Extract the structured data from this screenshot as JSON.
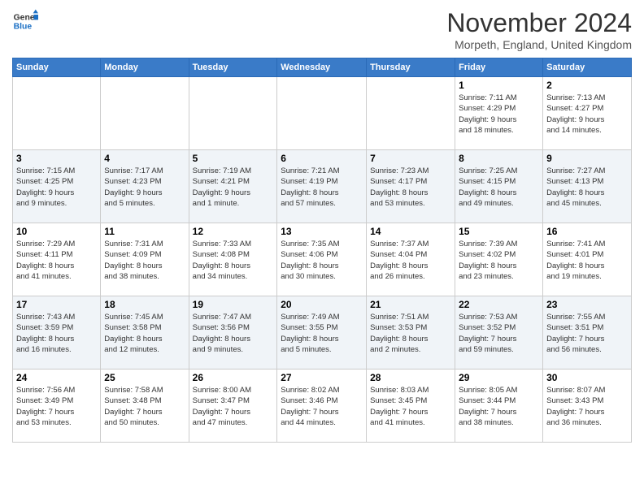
{
  "header": {
    "logo_line1": "General",
    "logo_line2": "Blue",
    "month": "November 2024",
    "location": "Morpeth, England, United Kingdom"
  },
  "weekdays": [
    "Sunday",
    "Monday",
    "Tuesday",
    "Wednesday",
    "Thursday",
    "Friday",
    "Saturday"
  ],
  "weeks": [
    [
      {
        "day": "",
        "info": ""
      },
      {
        "day": "",
        "info": ""
      },
      {
        "day": "",
        "info": ""
      },
      {
        "day": "",
        "info": ""
      },
      {
        "day": "",
        "info": ""
      },
      {
        "day": "1",
        "info": "Sunrise: 7:11 AM\nSunset: 4:29 PM\nDaylight: 9 hours\nand 18 minutes."
      },
      {
        "day": "2",
        "info": "Sunrise: 7:13 AM\nSunset: 4:27 PM\nDaylight: 9 hours\nand 14 minutes."
      }
    ],
    [
      {
        "day": "3",
        "info": "Sunrise: 7:15 AM\nSunset: 4:25 PM\nDaylight: 9 hours\nand 9 minutes."
      },
      {
        "day": "4",
        "info": "Sunrise: 7:17 AM\nSunset: 4:23 PM\nDaylight: 9 hours\nand 5 minutes."
      },
      {
        "day": "5",
        "info": "Sunrise: 7:19 AM\nSunset: 4:21 PM\nDaylight: 9 hours\nand 1 minute."
      },
      {
        "day": "6",
        "info": "Sunrise: 7:21 AM\nSunset: 4:19 PM\nDaylight: 8 hours\nand 57 minutes."
      },
      {
        "day": "7",
        "info": "Sunrise: 7:23 AM\nSunset: 4:17 PM\nDaylight: 8 hours\nand 53 minutes."
      },
      {
        "day": "8",
        "info": "Sunrise: 7:25 AM\nSunset: 4:15 PM\nDaylight: 8 hours\nand 49 minutes."
      },
      {
        "day": "9",
        "info": "Sunrise: 7:27 AM\nSunset: 4:13 PM\nDaylight: 8 hours\nand 45 minutes."
      }
    ],
    [
      {
        "day": "10",
        "info": "Sunrise: 7:29 AM\nSunset: 4:11 PM\nDaylight: 8 hours\nand 41 minutes."
      },
      {
        "day": "11",
        "info": "Sunrise: 7:31 AM\nSunset: 4:09 PM\nDaylight: 8 hours\nand 38 minutes."
      },
      {
        "day": "12",
        "info": "Sunrise: 7:33 AM\nSunset: 4:08 PM\nDaylight: 8 hours\nand 34 minutes."
      },
      {
        "day": "13",
        "info": "Sunrise: 7:35 AM\nSunset: 4:06 PM\nDaylight: 8 hours\nand 30 minutes."
      },
      {
        "day": "14",
        "info": "Sunrise: 7:37 AM\nSunset: 4:04 PM\nDaylight: 8 hours\nand 26 minutes."
      },
      {
        "day": "15",
        "info": "Sunrise: 7:39 AM\nSunset: 4:02 PM\nDaylight: 8 hours\nand 23 minutes."
      },
      {
        "day": "16",
        "info": "Sunrise: 7:41 AM\nSunset: 4:01 PM\nDaylight: 8 hours\nand 19 minutes."
      }
    ],
    [
      {
        "day": "17",
        "info": "Sunrise: 7:43 AM\nSunset: 3:59 PM\nDaylight: 8 hours\nand 16 minutes."
      },
      {
        "day": "18",
        "info": "Sunrise: 7:45 AM\nSunset: 3:58 PM\nDaylight: 8 hours\nand 12 minutes."
      },
      {
        "day": "19",
        "info": "Sunrise: 7:47 AM\nSunset: 3:56 PM\nDaylight: 8 hours\nand 9 minutes."
      },
      {
        "day": "20",
        "info": "Sunrise: 7:49 AM\nSunset: 3:55 PM\nDaylight: 8 hours\nand 5 minutes."
      },
      {
        "day": "21",
        "info": "Sunrise: 7:51 AM\nSunset: 3:53 PM\nDaylight: 8 hours\nand 2 minutes."
      },
      {
        "day": "22",
        "info": "Sunrise: 7:53 AM\nSunset: 3:52 PM\nDaylight: 7 hours\nand 59 minutes."
      },
      {
        "day": "23",
        "info": "Sunrise: 7:55 AM\nSunset: 3:51 PM\nDaylight: 7 hours\nand 56 minutes."
      }
    ],
    [
      {
        "day": "24",
        "info": "Sunrise: 7:56 AM\nSunset: 3:49 PM\nDaylight: 7 hours\nand 53 minutes."
      },
      {
        "day": "25",
        "info": "Sunrise: 7:58 AM\nSunset: 3:48 PM\nDaylight: 7 hours\nand 50 minutes."
      },
      {
        "day": "26",
        "info": "Sunrise: 8:00 AM\nSunset: 3:47 PM\nDaylight: 7 hours\nand 47 minutes."
      },
      {
        "day": "27",
        "info": "Sunrise: 8:02 AM\nSunset: 3:46 PM\nDaylight: 7 hours\nand 44 minutes."
      },
      {
        "day": "28",
        "info": "Sunrise: 8:03 AM\nSunset: 3:45 PM\nDaylight: 7 hours\nand 41 minutes."
      },
      {
        "day": "29",
        "info": "Sunrise: 8:05 AM\nSunset: 3:44 PM\nDaylight: 7 hours\nand 38 minutes."
      },
      {
        "day": "30",
        "info": "Sunrise: 8:07 AM\nSunset: 3:43 PM\nDaylight: 7 hours\nand 36 minutes."
      }
    ]
  ]
}
